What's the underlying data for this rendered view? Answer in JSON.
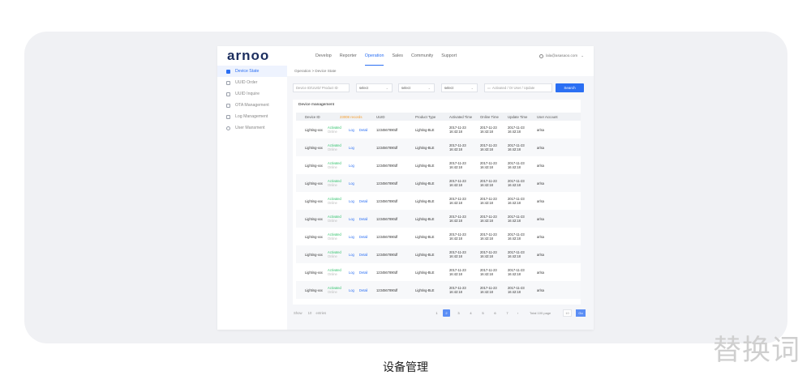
{
  "app": {
    "logo": "arnoo",
    "nav": [
      "Develop",
      "Reporter",
      "Operation",
      "Sales",
      "Community",
      "Support"
    ],
    "active_nav": "Operation",
    "user": "lala@asasaoo.com"
  },
  "sidebar": {
    "items": [
      {
        "label": "Device State",
        "icon": "grid-icon",
        "active": true
      },
      {
        "label": "UUID Order",
        "icon": "order-icon",
        "active": false
      },
      {
        "label": "UUID Inquire",
        "icon": "inquire-icon",
        "active": false
      },
      {
        "label": "OTA Management",
        "icon": "ota-icon",
        "active": false
      },
      {
        "label": "Log Management",
        "icon": "log-icon",
        "active": false
      },
      {
        "label": "User Mansment",
        "icon": "user-icon",
        "active": false
      }
    ]
  },
  "breadcrumb": "Operation  >  Device State",
  "filters": {
    "search_placeholder": "Device ID/UUID/ Product ID",
    "select1": "select",
    "select2": "select",
    "select3": "select",
    "date_placeholder": "Activated / Or User / Update",
    "search_button": "Search"
  },
  "table": {
    "title": "Device management",
    "columns": [
      "Device ID",
      "Status",
      "",
      "UUID",
      "Product Type",
      "Activated Time",
      "Online Time",
      "Update Time",
      "User Account"
    ],
    "records_label": "23008 records",
    "rows": [
      {
        "device_id": "Lighting-xxx",
        "status1": "Activated",
        "status2": "Online",
        "has_detail": true,
        "uuid": "1234567890df",
        "product_type": "Lighting-BLE",
        "activated": "2017-11-23 16:42:18",
        "online": "2017-11-23 16:42:18",
        "update": "2017-11-23 16:42:18",
        "user": "arlsa"
      },
      {
        "device_id": "Lighting-xxx",
        "status1": "Activated",
        "status2": "Online",
        "has_detail": false,
        "uuid": "1234567890df",
        "product_type": "Lighting-BLE",
        "activated": "2017-11-23 16:42:18",
        "online": "2017-11-23 16:42:18",
        "update": "2017-11-23 16:42:18",
        "user": "arlsa"
      },
      {
        "device_id": "Lighting-xxx",
        "status1": "Activated",
        "status2": "Online",
        "has_detail": false,
        "uuid": "1234567890df",
        "product_type": "Lighting-BLE",
        "activated": "2017-11-23 16:42:18",
        "online": "2017-11-23 16:42:18",
        "update": "2017-11-23 16:42:18",
        "user": "arlsa"
      },
      {
        "device_id": "Lighting-xxx",
        "status1": "Activated",
        "status2": "Online",
        "has_detail": false,
        "uuid": "1234567890df",
        "product_type": "Lighting-BLE",
        "activated": "2017-11-23 16:42:18",
        "online": "2017-11-23 16:42:18",
        "update": "2017-11-23 16:42:18",
        "user": "arlsa"
      },
      {
        "device_id": "Lighting-xxx",
        "status1": "Activated",
        "status2": "Online",
        "has_detail": true,
        "uuid": "1234567890df",
        "product_type": "Lighting-BLE",
        "activated": "2017-11-23 16:42:18",
        "online": "2017-11-23 16:42:18",
        "update": "2017-11-23 16:42:18",
        "user": "arlsa"
      },
      {
        "device_id": "Lighting-xxx",
        "status1": "Activated",
        "status2": "Online",
        "has_detail": true,
        "uuid": "1234567890df",
        "product_type": "Lighting-BLE",
        "activated": "2017-11-23 16:42:18",
        "online": "2017-11-23 16:42:18",
        "update": "2017-11-23 16:42:18",
        "user": "arlsa"
      },
      {
        "device_id": "Lighting-xxx",
        "status1": "Activated",
        "status2": "Online",
        "has_detail": true,
        "uuid": "1234567890df",
        "product_type": "Lighting-BLE",
        "activated": "2017-11-23 16:42:18",
        "online": "2017-11-23 16:42:18",
        "update": "2017-11-23 16:42:18",
        "user": "arlsa"
      },
      {
        "device_id": "Lighting-xxx",
        "status1": "Activated",
        "status2": "Online",
        "has_detail": true,
        "uuid": "1234567890df",
        "product_type": "Lighting-BLE",
        "activated": "2017-11-23 16:42:18",
        "online": "2017-11-23 16:42:18",
        "update": "2017-11-23 16:42:18",
        "user": "arlsa"
      },
      {
        "device_id": "Lighting-xxx",
        "status1": "Activated",
        "status2": "Online",
        "has_detail": true,
        "uuid": "1234567890df",
        "product_type": "Lighting-BLE",
        "activated": "2017-11-23 16:42:18",
        "online": "2017-11-23 16:42:18",
        "update": "2017-11-23 16:42:18",
        "user": "arlsa"
      },
      {
        "device_id": "Lighting-xxx",
        "status1": "Activated",
        "status2": "Online",
        "has_detail": true,
        "uuid": "1234567890df",
        "product_type": "Lighting-BLE",
        "activated": "2017-11-23 16:42:18",
        "online": "2017-11-23 16:42:18",
        "update": "2017-11-23 16:42:18",
        "user": "arlsa"
      }
    ],
    "log_label": "Log",
    "detail_label": "Detail"
  },
  "pagination": {
    "show_label": "Show",
    "show_value": "10",
    "entries_label": "entries",
    "pages": [
      "1",
      "2",
      "3",
      "4",
      "5",
      "6",
      "7"
    ],
    "active_page": "2",
    "total_label": "Total 100 page",
    "page_input": "10",
    "go_label": "Go"
  },
  "colors": {
    "accent": "#2b6ff3",
    "status_green": "#35c36e",
    "records_orange": "#f39b2a"
  },
  "caption": "设备管理",
  "watermark": "替换词"
}
